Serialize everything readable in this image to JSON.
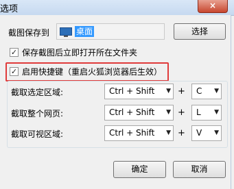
{
  "window": {
    "title": "选项",
    "close_glyph": "×"
  },
  "save_to": {
    "label": "截图保存到",
    "path_value": "桌面",
    "browse_label": "选择"
  },
  "options": {
    "open_folder_label": "保存截图后立即打开所在文件夹",
    "open_folder_checked": true,
    "hotkeys_label": "启用快捷键（重启火狐浏览器后生效）",
    "hotkeys_checked": true
  },
  "hotkeys": [
    {
      "label": "截取选定区域:",
      "modifier": "Ctrl + Shift",
      "plus": "+",
      "key": "C"
    },
    {
      "label": "截取整个网页:",
      "modifier": "Ctrl + Shift",
      "plus": "+",
      "key": "L"
    },
    {
      "label": "截取可视区域:",
      "modifier": "Ctrl + Shift",
      "plus": "+",
      "key": "V"
    }
  ],
  "buttons": {
    "ok": "确定",
    "cancel": "取消"
  },
  "colors": {
    "highlight_border": "#e03a3a",
    "selection": "#3399ff"
  }
}
